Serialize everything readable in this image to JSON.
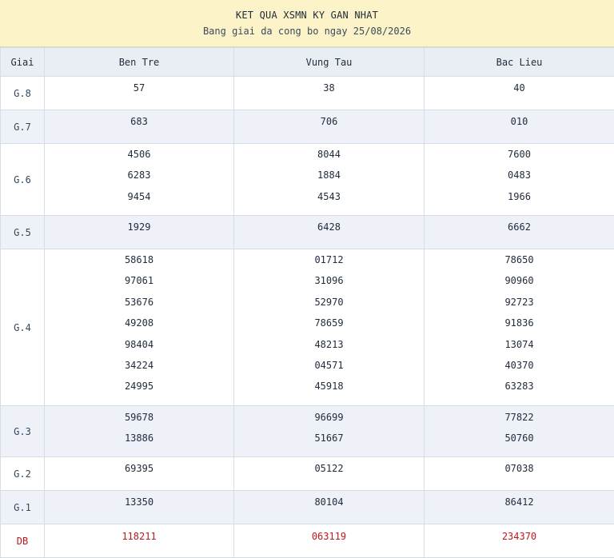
{
  "header": {
    "title": "KET QUA XSMN KY GAN NHAT",
    "subtitle": "Bang giai da cong bo ngay 25/08/2026"
  },
  "columns": {
    "prize": "Giai",
    "p1": "Ben Tre",
    "p2": "Vung Tau",
    "p3": "Bac Lieu"
  },
  "rows": [
    {
      "prize": "G.8",
      "p1": [
        "57"
      ],
      "p2": [
        "38"
      ],
      "p3": [
        "40"
      ]
    },
    {
      "prize": "G.7",
      "p1": [
        "683"
      ],
      "p2": [
        "706"
      ],
      "p3": [
        "010"
      ]
    },
    {
      "prize": "G.6",
      "p1": [
        "4506",
        "6283",
        "9454"
      ],
      "p2": [
        "8044",
        "1884",
        "4543"
      ],
      "p3": [
        "7600",
        "0483",
        "1966"
      ]
    },
    {
      "prize": "G.5",
      "p1": [
        "1929"
      ],
      "p2": [
        "6428"
      ],
      "p3": [
        "6662"
      ]
    },
    {
      "prize": "G.4",
      "p1": [
        "58618",
        "97061",
        "53676",
        "49208",
        "98404",
        "34224",
        "24995"
      ],
      "p2": [
        "01712",
        "31096",
        "52970",
        "78659",
        "48213",
        "04571",
        "45918"
      ],
      "p3": [
        "78650",
        "90960",
        "92723",
        "91836",
        "13074",
        "40370",
        "63283"
      ]
    },
    {
      "prize": "G.3",
      "p1": [
        "59678",
        "13886"
      ],
      "p2": [
        "96699",
        "51667"
      ],
      "p3": [
        "77822",
        "50760"
      ]
    },
    {
      "prize": "G.2",
      "p1": [
        "69395"
      ],
      "p2": [
        "05122"
      ],
      "p3": [
        "07038"
      ]
    },
    {
      "prize": "G.1",
      "p1": [
        "13350"
      ],
      "p2": [
        "80104"
      ],
      "p3": [
        "86412"
      ]
    },
    {
      "prize": "DB",
      "p1": [
        "118211"
      ],
      "p2": [
        "063119"
      ],
      "p3": [
        "234370"
      ]
    }
  ]
}
